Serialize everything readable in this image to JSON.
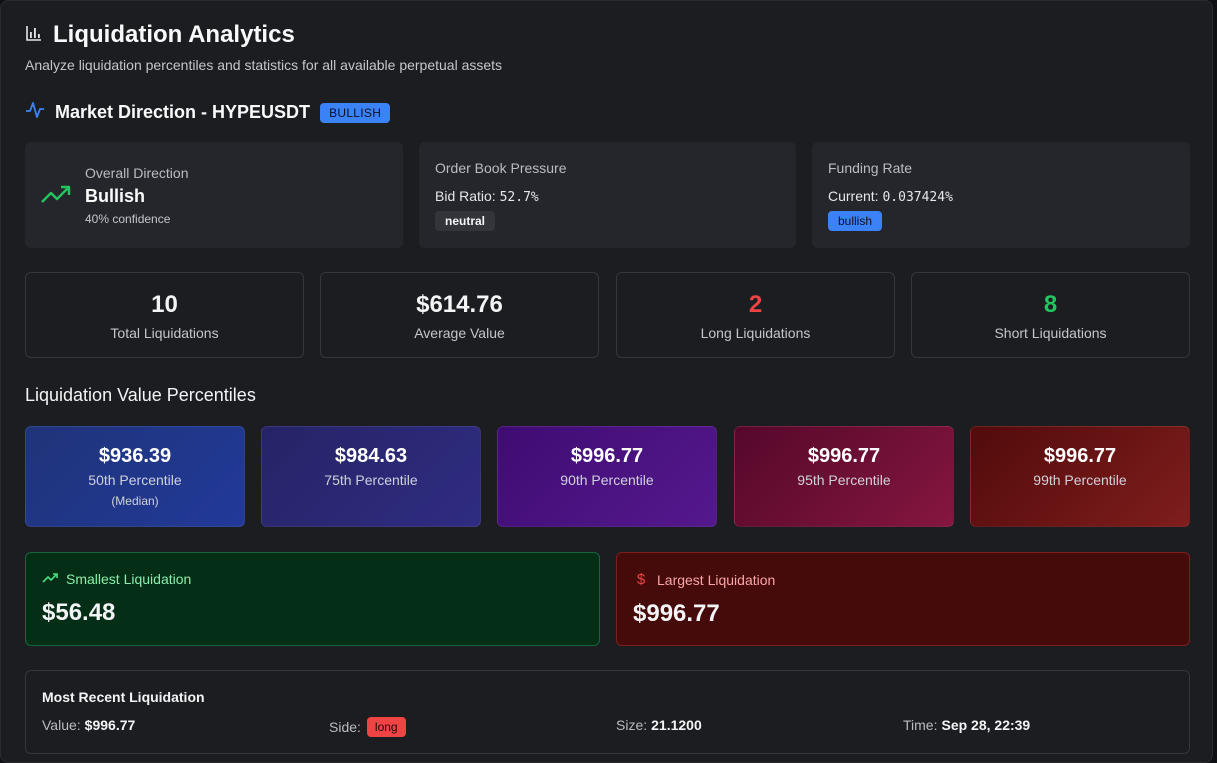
{
  "header": {
    "icon": "bar-chart-icon",
    "title": "Liquidation Analytics",
    "subtitle": "Analyze liquidation percentiles and statistics for all available perpetual assets"
  },
  "market_direction": {
    "icon": "activity-icon",
    "title": "Market Direction - HYPEUSDT",
    "badge": "BULLISH",
    "overall": {
      "label": "Overall Direction",
      "value": "Bullish",
      "confidence": "40% confidence",
      "icon": "trending-up-icon"
    },
    "order_book": {
      "label": "Order Book Pressure",
      "bid_label": "Bid Ratio:",
      "bid_value": "52.7%",
      "tag": "neutral"
    },
    "funding": {
      "label": "Funding Rate",
      "current_label": "Current:",
      "current_value": "0.037424%",
      "tag": "bullish"
    }
  },
  "stats": [
    {
      "value": "10",
      "label": "Total Liquidations",
      "color": "#f3f4f6"
    },
    {
      "value": "$614.76",
      "label": "Average Value",
      "color": "#f3f4f6"
    },
    {
      "value": "2",
      "label": "Long Liquidations",
      "color": "#ef4444"
    },
    {
      "value": "8",
      "label": "Short Liquidations",
      "color": "#22c55e"
    }
  ],
  "percentiles": {
    "title": "Liquidation Value Percentiles",
    "items": [
      {
        "value": "$936.39",
        "label": "50th Percentile",
        "sub": "(Median)"
      },
      {
        "value": "$984.63",
        "label": "75th Percentile"
      },
      {
        "value": "$996.77",
        "label": "90th Percentile"
      },
      {
        "value": "$996.77",
        "label": "95th Percentile"
      },
      {
        "value": "$996.77",
        "label": "99th Percentile"
      }
    ]
  },
  "smallest": {
    "label": "Smallest Liquidation",
    "value": "$56.48",
    "icon": "trending-up-icon"
  },
  "largest": {
    "label": "Largest Liquidation",
    "value": "$996.77",
    "icon": "dollar-icon"
  },
  "recent": {
    "title": "Most Recent Liquidation",
    "value_label": "Value:",
    "value": "$996.77",
    "side_label": "Side:",
    "side": "long",
    "size_label": "Size:",
    "size": "21.1200",
    "time_label": "Time:",
    "time": "Sep 28, 22:39"
  },
  "colors": {
    "accent_blue": "#3b82f6",
    "green": "#22c55e",
    "red": "#ef4444"
  }
}
